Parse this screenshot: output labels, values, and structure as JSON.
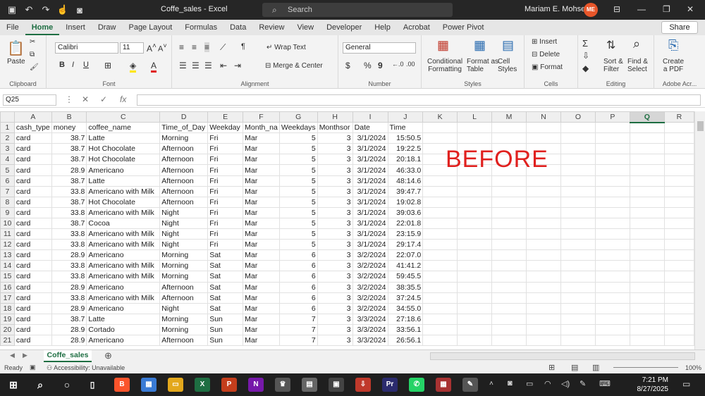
{
  "window": {
    "title": "Coffe_sales - Excel",
    "search_placeholder": "Search",
    "user_name": "Mariam E. Mohsen",
    "user_initials": "ME"
  },
  "tabs": [
    "File",
    "Home",
    "Insert",
    "Draw",
    "Page Layout",
    "Formulas",
    "Data",
    "Review",
    "View",
    "Developer",
    "Help",
    "Acrobat",
    "Power Pivot"
  ],
  "share_label": "Share",
  "ribbon": {
    "clipboard": {
      "paste": "Paste",
      "label": "Clipboard"
    },
    "font": {
      "name": "Calibri",
      "size": "11",
      "label": "Font"
    },
    "alignment": {
      "wrap": "Wrap Text",
      "merge": "Merge & Center",
      "label": "Alignment"
    },
    "number": {
      "format": "General",
      "label": "Number"
    },
    "styles": {
      "cond": "Conditional",
      "cond2": "Formatting",
      "table": "Format as",
      "table2": "Table",
      "cell": "Cell",
      "cell2": "Styles",
      "label": "Styles"
    },
    "cells": {
      "insert": "Insert",
      "delete": "Delete",
      "format": "Format",
      "label": "Cells"
    },
    "editing": {
      "sort": "Sort &",
      "sort2": "Filter",
      "find": "Find &",
      "find2": "Select",
      "label": "Editing"
    },
    "acrobat": {
      "create": "Create",
      "create2": "a PDF",
      "label": "Adobe Acr..."
    }
  },
  "formula_bar": {
    "name_box": "Q25",
    "fx": "fx"
  },
  "columns": [
    "A",
    "B",
    "C",
    "D",
    "E",
    "F",
    "G",
    "H",
    "I",
    "J",
    "K",
    "L",
    "M",
    "N",
    "O",
    "P",
    "Q",
    "R"
  ],
  "selected_column": "Q",
  "rows": [
    [
      "cash_type",
      "money",
      "coffee_name",
      "Time_of_Day",
      "Weekday",
      "Month_na",
      "Weekdays",
      "Monthsor",
      "Date",
      "Time"
    ],
    [
      "card",
      "38.7",
      "Latte",
      "Morning",
      "Fri",
      "Mar",
      "5",
      "3",
      "3/1/2024",
      "15:50.5"
    ],
    [
      "card",
      "38.7",
      "Hot Chocolate",
      "Afternoon",
      "Fri",
      "Mar",
      "5",
      "3",
      "3/1/2024",
      "19:22.5"
    ],
    [
      "card",
      "38.7",
      "Hot Chocolate",
      "Afternoon",
      "Fri",
      "Mar",
      "5",
      "3",
      "3/1/2024",
      "20:18.1"
    ],
    [
      "card",
      "28.9",
      "Americano",
      "Afternoon",
      "Fri",
      "Mar",
      "5",
      "3",
      "3/1/2024",
      "46:33.0"
    ],
    [
      "card",
      "38.7",
      "Latte",
      "Afternoon",
      "Fri",
      "Mar",
      "5",
      "3",
      "3/1/2024",
      "48:14.6"
    ],
    [
      "card",
      "33.8",
      "Americano with Milk",
      "Afternoon",
      "Fri",
      "Mar",
      "5",
      "3",
      "3/1/2024",
      "39:47.7"
    ],
    [
      "card",
      "38.7",
      "Hot Chocolate",
      "Afternoon",
      "Fri",
      "Mar",
      "5",
      "3",
      "3/1/2024",
      "19:02.8"
    ],
    [
      "card",
      "33.8",
      "Americano with Milk",
      "Night",
      "Fri",
      "Mar",
      "5",
      "3",
      "3/1/2024",
      "39:03.6"
    ],
    [
      "card",
      "38.7",
      "Cocoa",
      "Night",
      "Fri",
      "Mar",
      "5",
      "3",
      "3/1/2024",
      "22:01.8"
    ],
    [
      "card",
      "33.8",
      "Americano with Milk",
      "Night",
      "Fri",
      "Mar",
      "5",
      "3",
      "3/1/2024",
      "23:15.9"
    ],
    [
      "card",
      "33.8",
      "Americano with Milk",
      "Night",
      "Fri",
      "Mar",
      "5",
      "3",
      "3/1/2024",
      "29:17.4"
    ],
    [
      "card",
      "28.9",
      "Americano",
      "Morning",
      "Sat",
      "Mar",
      "6",
      "3",
      "3/2/2024",
      "22:07.0"
    ],
    [
      "card",
      "33.8",
      "Americano with Milk",
      "Morning",
      "Sat",
      "Mar",
      "6",
      "3",
      "3/2/2024",
      "41:41.2"
    ],
    [
      "card",
      "33.8",
      "Americano with Milk",
      "Morning",
      "Sat",
      "Mar",
      "6",
      "3",
      "3/2/2024",
      "59:45.5"
    ],
    [
      "card",
      "28.9",
      "Americano",
      "Afternoon",
      "Sat",
      "Mar",
      "6",
      "3",
      "3/2/2024",
      "38:35.5"
    ],
    [
      "card",
      "33.8",
      "Americano with Milk",
      "Afternoon",
      "Sat",
      "Mar",
      "6",
      "3",
      "3/2/2024",
      "37:24.5"
    ],
    [
      "card",
      "28.9",
      "Americano",
      "Night",
      "Sat",
      "Mar",
      "6",
      "3",
      "3/2/2024",
      "34:55.0"
    ],
    [
      "card",
      "38.7",
      "Latte",
      "Morning",
      "Sun",
      "Mar",
      "7",
      "3",
      "3/3/2024",
      "27:18.6"
    ],
    [
      "card",
      "28.9",
      "Cortado",
      "Morning",
      "Sun",
      "Mar",
      "7",
      "3",
      "3/3/2024",
      "33:56.1"
    ],
    [
      "card",
      "28.9",
      "Americano",
      "Afternoon",
      "Sun",
      "Mar",
      "7",
      "3",
      "3/3/2024",
      "26:56.1"
    ]
  ],
  "overlay_text": "BEFORE",
  "sheet_tab": "Coffe_sales",
  "status": {
    "ready": "Ready",
    "accessibility": "Accessibility: Unavailable",
    "zoom": "100%"
  },
  "clock": {
    "time": "7:21 PM",
    "date": "8/27/2025"
  },
  "colors": {
    "excel_green": "#1e6e42",
    "before_red": "#e0201e",
    "avatar": "#e8562a"
  }
}
